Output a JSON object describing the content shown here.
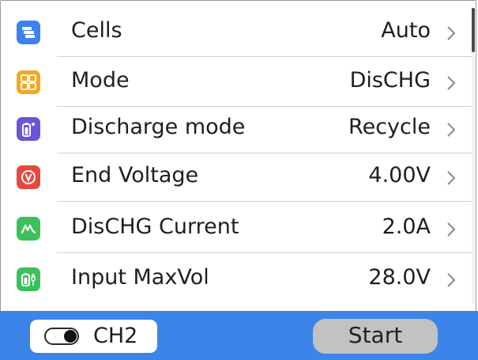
{
  "settings": [
    {
      "label": "Cells",
      "value": "Auto",
      "icon": "stack-layers-icon",
      "color": "#3b82f0"
    },
    {
      "label": "Mode",
      "value": "DisCHG",
      "icon": "grid-squares-icon",
      "color": "#f5a623"
    },
    {
      "label": "Discharge mode",
      "value": "Recycle",
      "icon": "battery-spark-icon",
      "color": "#6a55d8"
    },
    {
      "label": "End Voltage",
      "value": "4.00V",
      "icon": "voltage-v-icon",
      "color": "#e8483e"
    },
    {
      "label": "DisCHG Current",
      "value": "2.0A",
      "icon": "current-wave-icon",
      "color": "#3cc15a"
    },
    {
      "label": "Input MaxVol",
      "value": "28.0V",
      "icon": "battery-plug-icon",
      "color": "#3cc15a"
    }
  ],
  "footer": {
    "channel_label": "CH2",
    "start_label": "Start",
    "background": "#3c84e8"
  }
}
